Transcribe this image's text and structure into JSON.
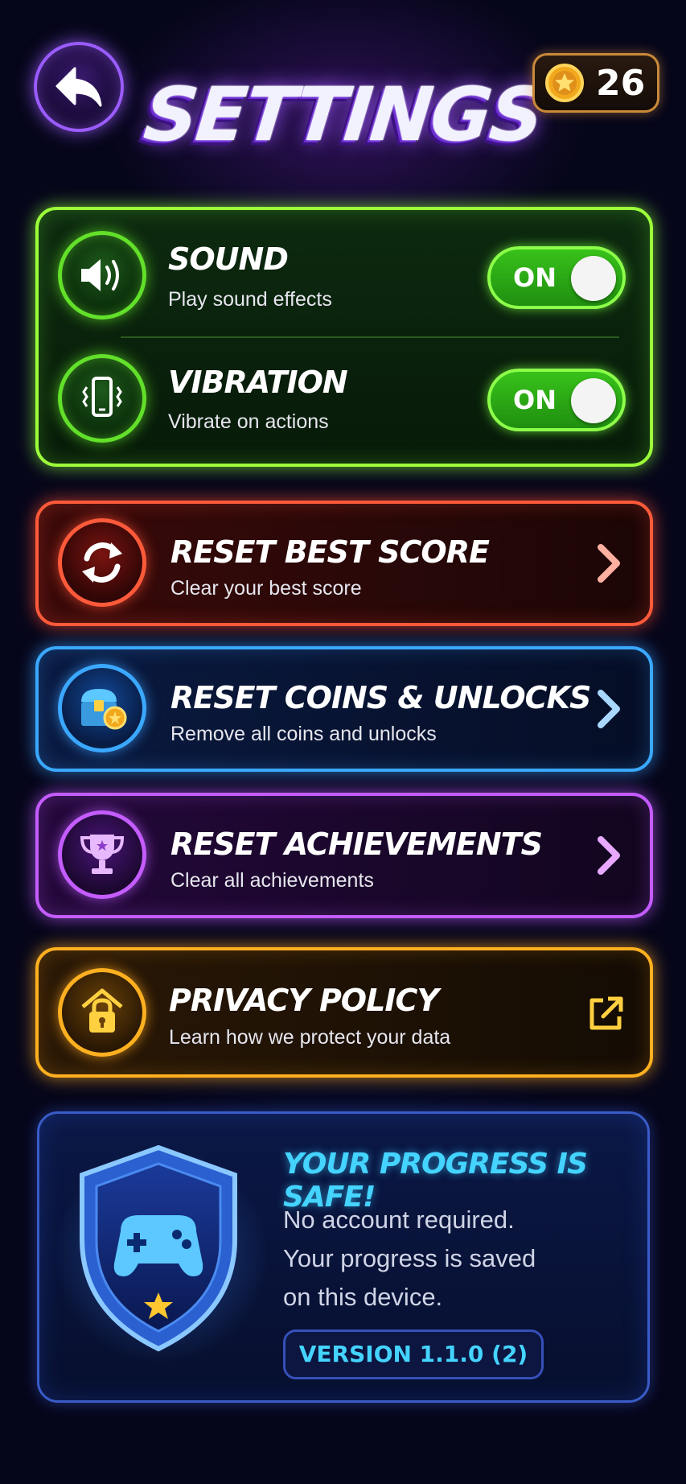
{
  "header": {
    "title": "SETTINGS",
    "coin_count": "26",
    "back_icon": "arrow-left-icon",
    "coin_icon": "coin-star-icon"
  },
  "audio": {
    "sound": {
      "title": "SOUND",
      "subtitle": "Play sound effects",
      "toggle_label": "ON",
      "enabled": true
    },
    "vibration": {
      "title": "VIBRATION",
      "subtitle": "Vibrate on actions",
      "toggle_label": "ON",
      "enabled": true
    }
  },
  "actions": [
    {
      "title": "RESET BEST SCORE",
      "subtitle": "Clear your best score",
      "color": "#ff5a3a",
      "icon": "refresh-icon"
    },
    {
      "title": "RESET COINS & UNLOCKS",
      "subtitle": "Remove all coins and unlocks",
      "color": "#3aa8ff",
      "icon": "treasure-chest-icon"
    },
    {
      "title": "RESET ACHIEVEMENTS",
      "subtitle": "Clear all achievements",
      "color": "#c45cff",
      "icon": "trophy-icon"
    },
    {
      "title": "PRIVACY POLICY",
      "subtitle": "Learn how we protect your data",
      "color": "#ffb020",
      "icon": "lock-icon"
    }
  ],
  "info": {
    "title": "YOUR PROGRESS IS SAFE!",
    "lines": [
      "No account required.",
      "Your progress is saved",
      "on this device."
    ],
    "version": "VERSION 1.1.0 (2)"
  },
  "colors": {
    "background": "#06061a",
    "green": "#9cff3a",
    "red": "#ff5a3a",
    "blue": "#3aa8ff",
    "purple": "#c45cff",
    "orange": "#ffb020",
    "cyan": "#44d4ff"
  }
}
